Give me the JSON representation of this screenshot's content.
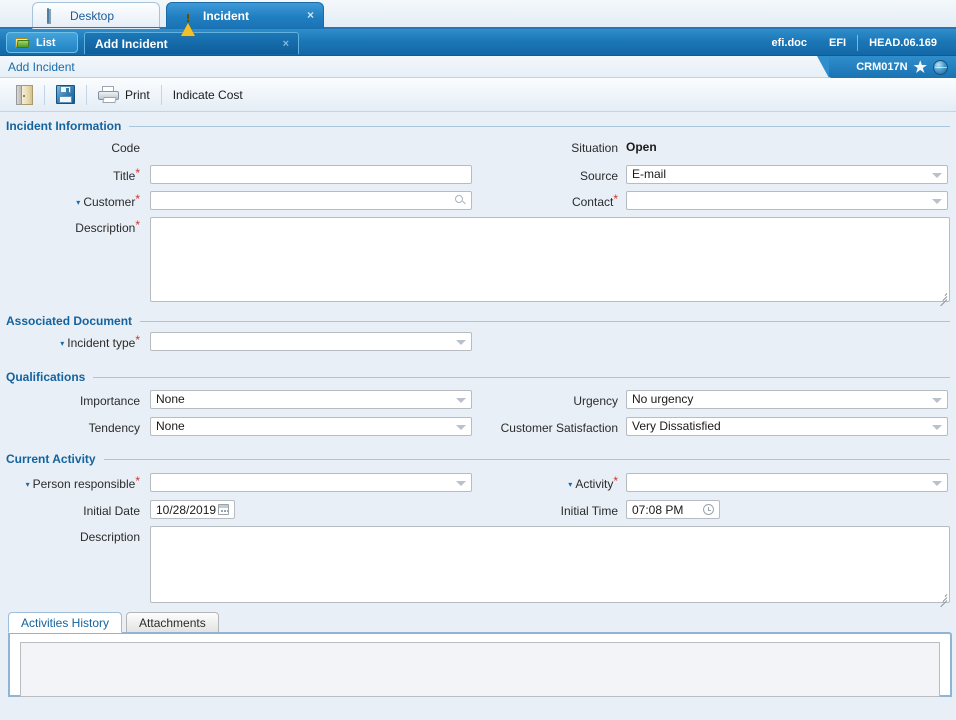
{
  "window": {
    "tabs": [
      {
        "label": "Desktop",
        "icon": "monitor-icon",
        "active": false
      },
      {
        "label": "Incident",
        "icon": "warning-triangle-icon",
        "active": true,
        "close": "×"
      }
    ]
  },
  "command_bar": {
    "list_button": "List",
    "list_icon": "folder-icon",
    "active_subtab": "Add Incident",
    "subtab_close": "×",
    "right_items": [
      "efi.doc",
      "EFI",
      "HEAD.06.169"
    ]
  },
  "breadcrumb": {
    "text": "Add Incident",
    "right_label": "CRM017N",
    "star_icon": "★",
    "globe_icon": "globe-icon"
  },
  "toolbar": {
    "exit_icon": "door-exit-icon",
    "save_icon": "save-floppy-icon",
    "print_icon": "printer-icon",
    "print_label": "Print",
    "indicate_cost_label": "Indicate Cost"
  },
  "sections": {
    "incident_information": {
      "title": "Incident Information",
      "code_label": "Code",
      "title_label": "Title",
      "customer_label": "Customer",
      "description_label": "Description",
      "situation_label": "Situation",
      "situation_value": "Open",
      "source_label": "Source",
      "source_value": "E-mail",
      "contact_label": "Contact",
      "contact_value": "",
      "title_value": "",
      "customer_value": "",
      "description_value": ""
    },
    "associated_document": {
      "title": "Associated Document",
      "incident_type_label": "Incident type",
      "incident_type_value": ""
    },
    "qualifications": {
      "title": "Qualifications",
      "importance_label": "Importance",
      "importance_value": "None",
      "tendency_label": "Tendency",
      "tendency_value": "None",
      "urgency_label": "Urgency",
      "urgency_value": "No urgency",
      "satisfaction_label": "Customer Satisfaction",
      "satisfaction_value": "Very Dissatisfied"
    },
    "current_activity": {
      "title": "Current Activity",
      "person_responsible_label": "Person responsible",
      "person_responsible_value": "",
      "activity_label": "Activity",
      "activity_value": "",
      "initial_date_label": "Initial Date",
      "initial_date_value": "10/28/2019",
      "initial_time_label": "Initial Time",
      "initial_time_value": "07:08 PM",
      "description_label": "Description",
      "description_value": ""
    }
  },
  "bottom_tabs": [
    {
      "label": "Activities History",
      "active": true
    },
    {
      "label": "Attachments",
      "active": false
    }
  ],
  "markers": {
    "required": "*",
    "caret": "▾"
  },
  "colors": {
    "accent_blue": "#1c76b6",
    "section_title": "#14639f",
    "required_red": "#d0342c",
    "page_bg": "#e9eff6"
  }
}
